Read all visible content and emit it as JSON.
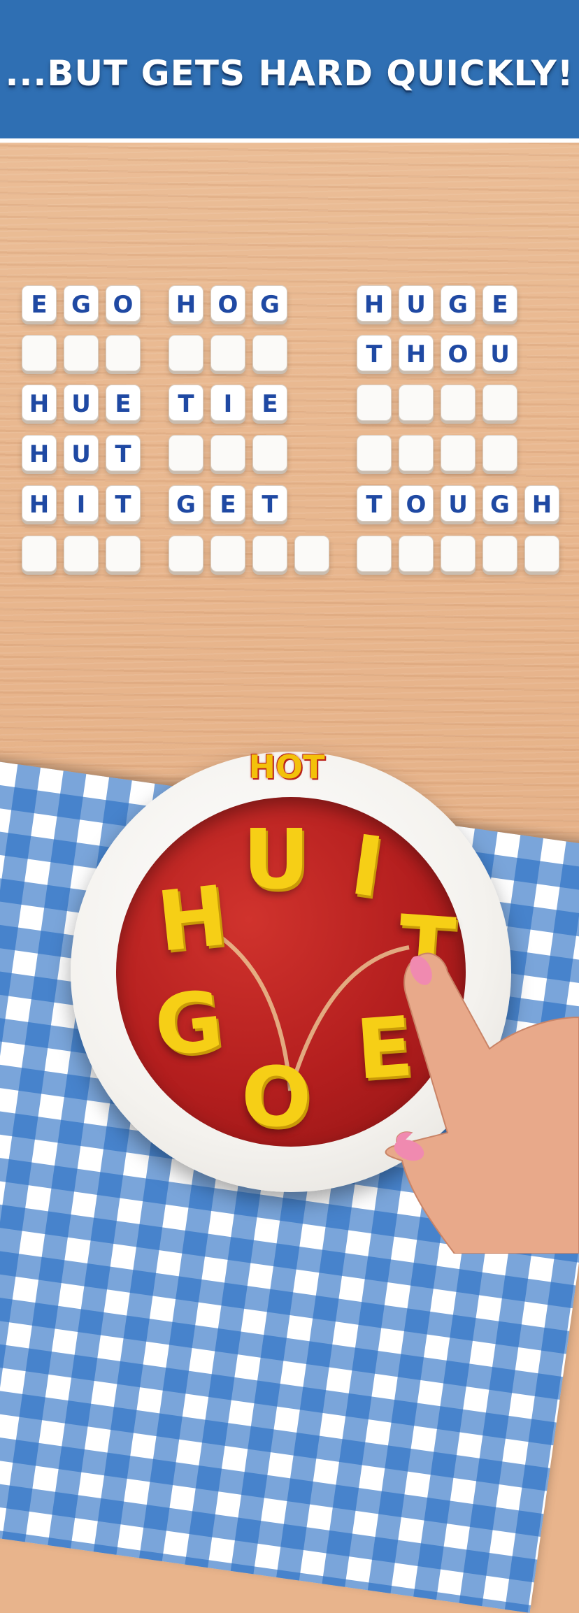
{
  "banner": {
    "title": "...BUT GETS HARD QUICKLY!"
  },
  "puzzle": {
    "columns": [
      {
        "rows": [
          {
            "letters": [
              "E",
              "G",
              "O"
            ],
            "solved": true
          },
          {
            "letters": [
              "",
              "",
              ""
            ],
            "solved": false
          },
          {
            "letters": [
              "H",
              "U",
              "E"
            ],
            "solved": true
          },
          {
            "letters": [
              "H",
              "U",
              "T"
            ],
            "solved": true
          },
          {
            "letters": [
              "H",
              "I",
              "T"
            ],
            "solved": true
          },
          {
            "letters": [
              "",
              "",
              ""
            ],
            "solved": false
          }
        ]
      },
      {
        "rows": [
          {
            "letters": [
              "H",
              "O",
              "G"
            ],
            "solved": true
          },
          {
            "letters": [
              "",
              "",
              ""
            ],
            "solved": false
          },
          {
            "letters": [
              "T",
              "I",
              "E"
            ],
            "solved": true
          },
          {
            "letters": [
              "",
              "",
              ""
            ],
            "solved": false
          },
          {
            "letters": [
              "G",
              "E",
              "T"
            ],
            "solved": true
          },
          {
            "letters": [
              "",
              "",
              "",
              ""
            ],
            "solved": false
          }
        ]
      },
      {
        "rows": [
          {
            "letters": [
              "H",
              "U",
              "G",
              "E"
            ],
            "solved": true
          },
          {
            "letters": [
              "T",
              "H",
              "O",
              "U"
            ],
            "solved": true
          },
          {
            "letters": [
              "",
              "",
              "",
              ""
            ],
            "solved": false
          },
          {
            "letters": [
              "",
              "",
              "",
              ""
            ],
            "solved": false
          },
          {
            "letters": [
              "T",
              "O",
              "U",
              "G",
              "H"
            ],
            "solved": true
          },
          {
            "letters": [
              "",
              "",
              "",
              "",
              ""
            ],
            "solved": false
          }
        ]
      }
    ]
  },
  "bowl": {
    "current_word": "HOT",
    "letters": [
      "H",
      "U",
      "I",
      "T",
      "E",
      "O",
      "G"
    ]
  },
  "colors": {
    "banner": "#2f6fb3",
    "tile_letter": "#1f49a3",
    "pasta": "#f6cf16",
    "soup": "#b31e1e"
  }
}
